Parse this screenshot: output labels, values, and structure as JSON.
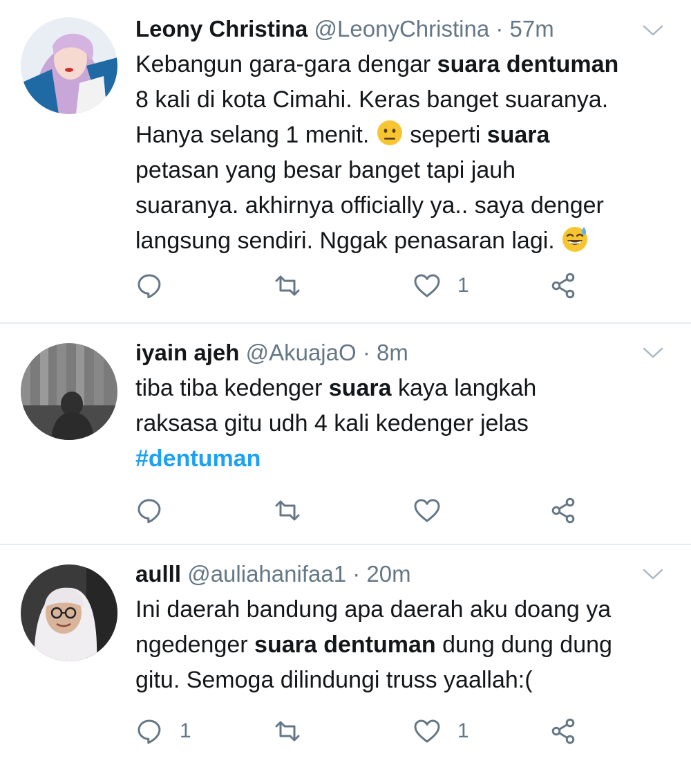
{
  "tweets": [
    {
      "name": "Leony Christina",
      "handle": "@LeonyChristina",
      "separator": "·",
      "time": "57m",
      "text_parts": [
        "Kebangun gara-gara dengar ",
        "suara dentuman",
        "\n8 kali di kota Cimahi. Keras banget suaranya.\nHanya selang 1 menit. ",
        " seperti ",
        "suara",
        "\npetasan yang besar banget tapi jauh\nsuaranya. akhirnya officially ya.. saya denger\nlangsung sendiri. Nggak penasaran lagi. "
      ],
      "emojis": [
        "neutral-face",
        "grinning-sweat-face"
      ],
      "reply_count": "",
      "retweet_count": "",
      "like_count": "1"
    },
    {
      "name": "iyain ajeh",
      "handle": "@AkuajaO",
      "separator": "·",
      "time": "8m",
      "text_parts": [
        "tiba tiba kedenger ",
        "suara",
        " kaya langkah\nraksasa gitu udh 4 kali kedenger jelas\n",
        "#dentuman"
      ],
      "reply_count": "",
      "retweet_count": "",
      "like_count": ""
    },
    {
      "name": "aulll",
      "handle": "@auliahanifaa1",
      "separator": "·",
      "time": "20m",
      "text_parts": [
        "Ini daerah bandung apa daerah aku doang ya\nngedenger ",
        "suara dentuman",
        " dung dung dung\ngitu. Semoga dilindungi truss yaallah:("
      ],
      "reply_count": "1",
      "retweet_count": "",
      "like_count": "1"
    }
  ],
  "icons": {
    "reply": "reply-icon",
    "retweet": "retweet-icon",
    "like": "heart-icon",
    "share": "share-icon",
    "menu": "chevron-down-icon"
  },
  "colors": {
    "text": "#14171a",
    "secondary": "#657786",
    "link": "#1da1f2",
    "divider": "#e6ecf0"
  }
}
